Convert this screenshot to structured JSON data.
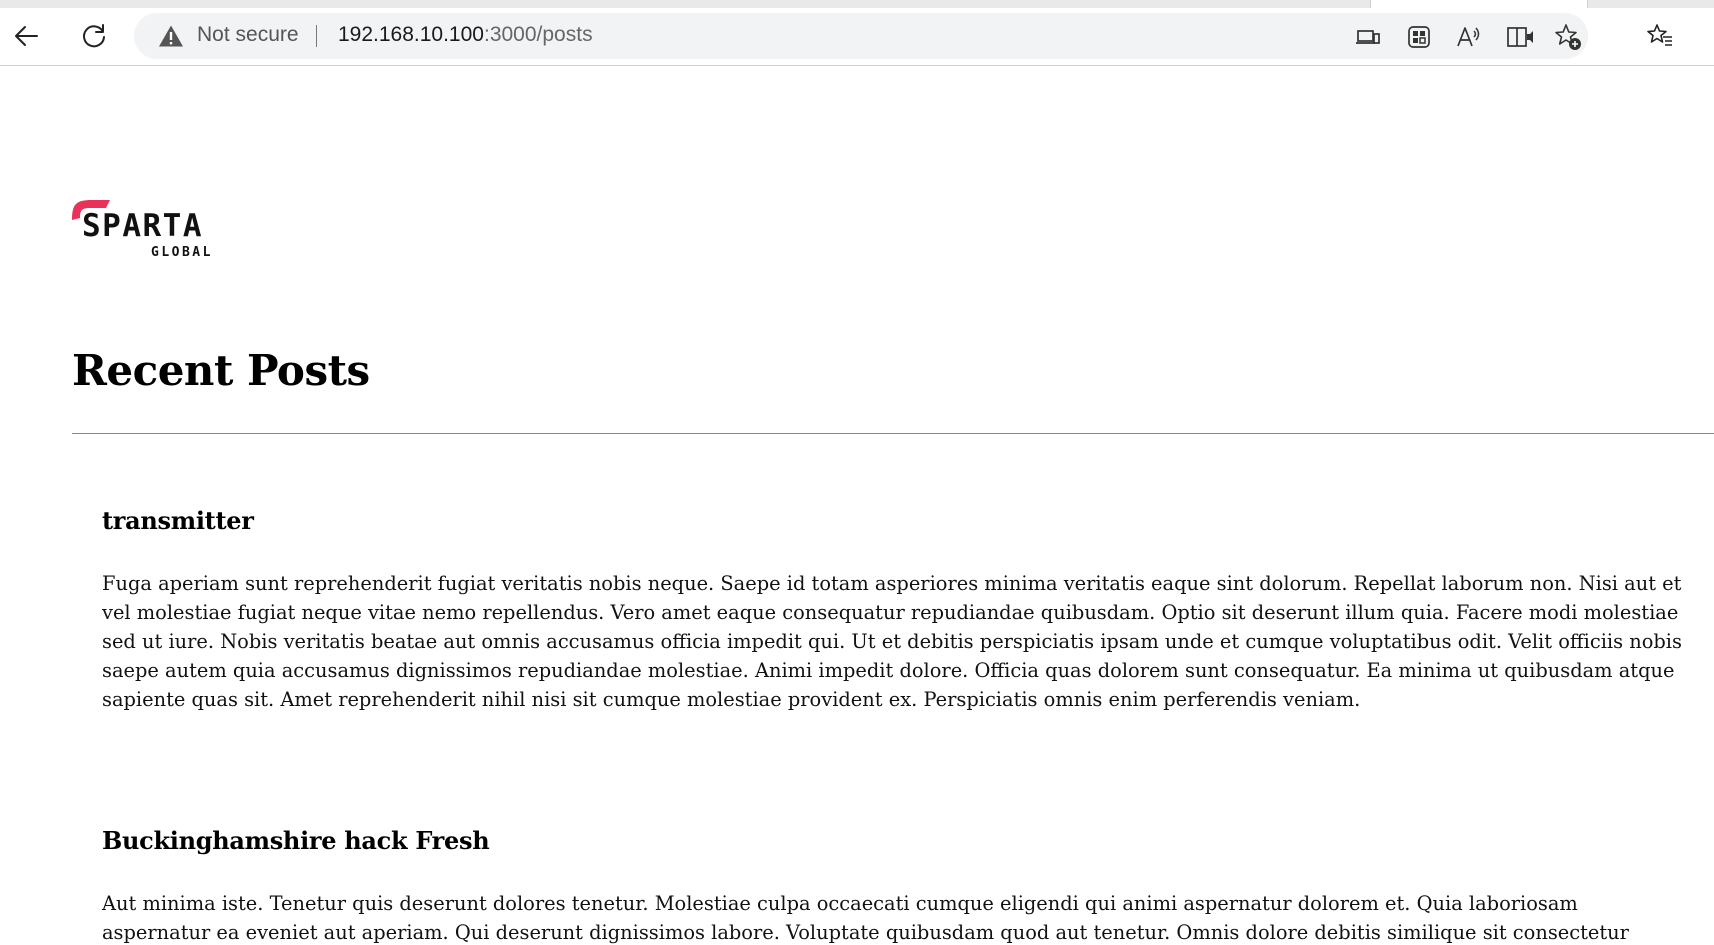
{
  "browser": {
    "address_bar": {
      "security_label": "Not secure",
      "url_host": "192.168.10.100",
      "url_path": ":3000/posts"
    },
    "icons": {
      "back": "back-arrow-icon",
      "reload": "reload-icon",
      "warning": "warning-triangle-icon",
      "app_available": "app-available-icon",
      "extensions": "extensions-grid-icon",
      "read_aloud": "read-aloud-icon",
      "immersive_reader": "immersive-reader-icon",
      "add_favorite": "add-favorite-icon",
      "favorites": "favorites-list-icon"
    }
  },
  "page": {
    "logo": {
      "text_main": "SPARTA",
      "text_sub": "GLOBAL",
      "accent_color": "#e8325a"
    },
    "title": "Recent Posts",
    "posts": [
      {
        "title": "transmitter",
        "body": "Fuga aperiam sunt reprehenderit fugiat veritatis nobis neque. Saepe id totam asperiores minima veritatis eaque sint dolorum. Repellat laborum non. Nisi aut et vel molestiae fugiat neque vitae nemo repellendus. Vero amet eaque consequatur repudiandae quibusdam. Optio sit deserunt illum quia. Facere modi molestiae sed ut iure. Nobis veritatis beatae aut omnis accusamus officia impedit qui. Ut et debitis perspiciatis ipsam unde et cumque voluptatibus odit. Velit officiis nobis saepe autem quia accusamus dignissimos repudiandae molestiae. Animi impedit dolore. Officia quas dolorem sunt consequatur. Ea minima ut quibusdam atque sapiente quas sit. Amet reprehenderit nihil nisi sit cumque molestiae provident ex. Perspiciatis omnis enim perferendis veniam."
      },
      {
        "title": "Buckinghamshire hack Fresh",
        "body": "Aut minima iste. Tenetur quis deserunt dolores tenetur. Molestiae culpa occaecati cumque eligendi qui animi aspernatur dolorem et. Quia laboriosam aspernatur ea eveniet aut aperiam. Qui deserunt dignissimos labore. Voluptate quibusdam quod aut tenetur. Omnis dolore debitis similique sit consectetur expedita ipsa. Ea fugiat"
      }
    ]
  }
}
